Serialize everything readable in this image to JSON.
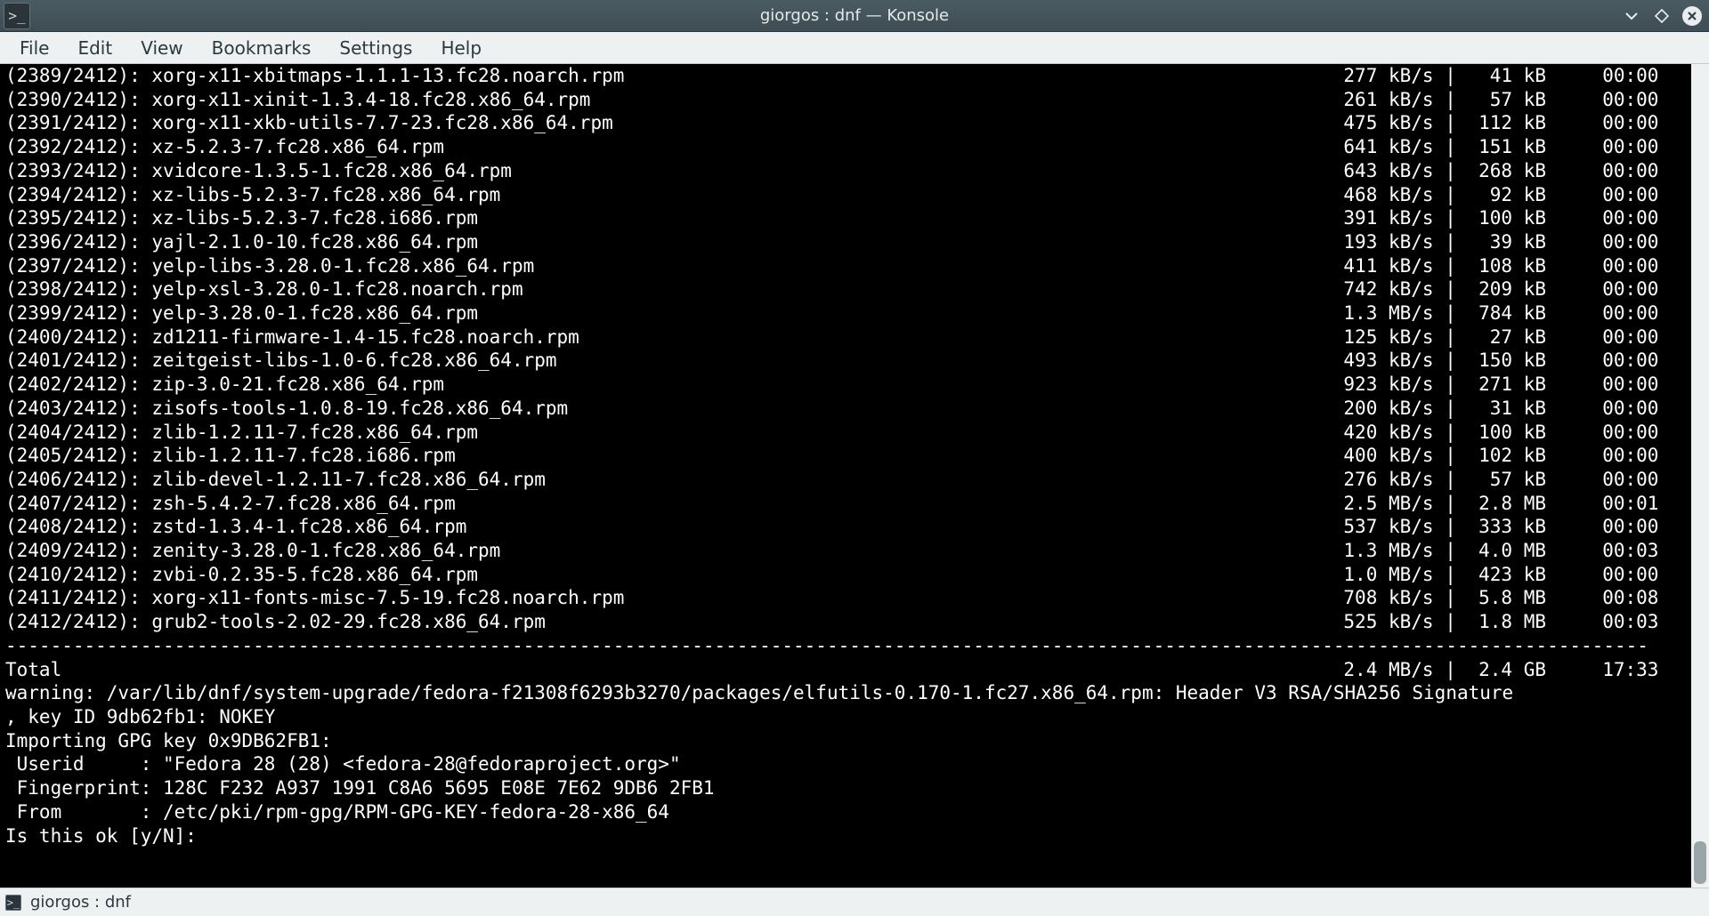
{
  "titlebar": {
    "icon_glyph": ">_",
    "title": "giorgos : dnf — Konsole"
  },
  "menubar": {
    "items": [
      "File",
      "Edit",
      "View",
      "Bookmarks",
      "Settings",
      "Help"
    ]
  },
  "terminal": {
    "download_rows": [
      {
        "idx": "(2389/2412):",
        "name": "xorg-x11-xbitmaps-1.1.1-13.fc28.noarch.rpm",
        "rate": "277 kB/s",
        "size": " 41 kB",
        "time": "00:00"
      },
      {
        "idx": "(2390/2412):",
        "name": "xorg-x11-xinit-1.3.4-18.fc28.x86_64.rpm",
        "rate": "261 kB/s",
        "size": " 57 kB",
        "time": "00:00"
      },
      {
        "idx": "(2391/2412):",
        "name": "xorg-x11-xkb-utils-7.7-23.fc28.x86_64.rpm",
        "rate": "475 kB/s",
        "size": "112 kB",
        "time": "00:00"
      },
      {
        "idx": "(2392/2412):",
        "name": "xz-5.2.3-7.fc28.x86_64.rpm",
        "rate": "641 kB/s",
        "size": "151 kB",
        "time": "00:00"
      },
      {
        "idx": "(2393/2412):",
        "name": "xvidcore-1.3.5-1.fc28.x86_64.rpm",
        "rate": "643 kB/s",
        "size": "268 kB",
        "time": "00:00"
      },
      {
        "idx": "(2394/2412):",
        "name": "xz-libs-5.2.3-7.fc28.x86_64.rpm",
        "rate": "468 kB/s",
        "size": " 92 kB",
        "time": "00:00"
      },
      {
        "idx": "(2395/2412):",
        "name": "xz-libs-5.2.3-7.fc28.i686.rpm",
        "rate": "391 kB/s",
        "size": "100 kB",
        "time": "00:00"
      },
      {
        "idx": "(2396/2412):",
        "name": "yajl-2.1.0-10.fc28.x86_64.rpm",
        "rate": "193 kB/s",
        "size": " 39 kB",
        "time": "00:00"
      },
      {
        "idx": "(2397/2412):",
        "name": "yelp-libs-3.28.0-1.fc28.x86_64.rpm",
        "rate": "411 kB/s",
        "size": "108 kB",
        "time": "00:00"
      },
      {
        "idx": "(2398/2412):",
        "name": "yelp-xsl-3.28.0-1.fc28.noarch.rpm",
        "rate": "742 kB/s",
        "size": "209 kB",
        "time": "00:00"
      },
      {
        "idx": "(2399/2412):",
        "name": "yelp-3.28.0-1.fc28.x86_64.rpm",
        "rate": "1.3 MB/s",
        "size": "784 kB",
        "time": "00:00"
      },
      {
        "idx": "(2400/2412):",
        "name": "zd1211-firmware-1.4-15.fc28.noarch.rpm",
        "rate": "125 kB/s",
        "size": " 27 kB",
        "time": "00:00"
      },
      {
        "idx": "(2401/2412):",
        "name": "zeitgeist-libs-1.0-6.fc28.x86_64.rpm",
        "rate": "493 kB/s",
        "size": "150 kB",
        "time": "00:00"
      },
      {
        "idx": "(2402/2412):",
        "name": "zip-3.0-21.fc28.x86_64.rpm",
        "rate": "923 kB/s",
        "size": "271 kB",
        "time": "00:00"
      },
      {
        "idx": "(2403/2412):",
        "name": "zisofs-tools-1.0.8-19.fc28.x86_64.rpm",
        "rate": "200 kB/s",
        "size": " 31 kB",
        "time": "00:00"
      },
      {
        "idx": "(2404/2412):",
        "name": "zlib-1.2.11-7.fc28.x86_64.rpm",
        "rate": "420 kB/s",
        "size": "100 kB",
        "time": "00:00"
      },
      {
        "idx": "(2405/2412):",
        "name": "zlib-1.2.11-7.fc28.i686.rpm",
        "rate": "400 kB/s",
        "size": "102 kB",
        "time": "00:00"
      },
      {
        "idx": "(2406/2412):",
        "name": "zlib-devel-1.2.11-7.fc28.x86_64.rpm",
        "rate": "276 kB/s",
        "size": " 57 kB",
        "time": "00:00"
      },
      {
        "idx": "(2407/2412):",
        "name": "zsh-5.4.2-7.fc28.x86_64.rpm",
        "rate": "2.5 MB/s",
        "size": "2.8 MB",
        "time": "00:01"
      },
      {
        "idx": "(2408/2412):",
        "name": "zstd-1.3.4-1.fc28.x86_64.rpm",
        "rate": "537 kB/s",
        "size": "333 kB",
        "time": "00:00"
      },
      {
        "idx": "(2409/2412):",
        "name": "zenity-3.28.0-1.fc28.x86_64.rpm",
        "rate": "1.3 MB/s",
        "size": "4.0 MB",
        "time": "00:03"
      },
      {
        "idx": "(2410/2412):",
        "name": "zvbi-0.2.35-5.fc28.x86_64.rpm",
        "rate": "1.0 MB/s",
        "size": "423 kB",
        "time": "00:00"
      },
      {
        "idx": "(2411/2412):",
        "name": "xorg-x11-fonts-misc-7.5-19.fc28.noarch.rpm",
        "rate": "708 kB/s",
        "size": "5.8 MB",
        "time": "00:08"
      },
      {
        "idx": "(2412/2412):",
        "name": "grub2-tools-2.02-29.fc28.x86_64.rpm",
        "rate": "525 kB/s",
        "size": "1.8 MB",
        "time": "00:03"
      }
    ],
    "total_label": "Total",
    "total_rate": "2.4 MB/s",
    "total_size": "2.4 GB",
    "total_time": "17:33",
    "footer_lines": [
      "warning: /var/lib/dnf/system-upgrade/fedora-f21308f6293b3270/packages/elfutils-0.170-1.fc27.x86_64.rpm: Header V3 RSA/SHA256 Signature",
      ", key ID 9db62fb1: NOKEY",
      "Importing GPG key 0x9DB62FB1:",
      " Userid     : \"Fedora 28 (28) <fedora-28@fedoraproject.org>\"",
      " Fingerprint: 128C F232 A937 1991 C8A6 5695 E08E 7E62 9DB6 2FB1",
      " From       : /etc/pki/rpm-gpg/RPM-GPG-KEY-fedora-28-x86_64",
      "Is this ok [y/N]: "
    ]
  },
  "tabbar": {
    "tab_label": "giorgos : dnf",
    "tab_icon_glyph": ">_"
  }
}
